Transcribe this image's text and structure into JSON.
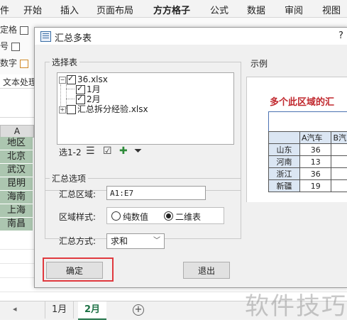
{
  "ribbon": {
    "tabs": [
      "件",
      "开始",
      "插入",
      "页面布局",
      "方方格子",
      "公式",
      "数据",
      "审阅",
      "视图"
    ],
    "active_tab": "方方格子",
    "left_items": [
      "定格",
      "号",
      "数字"
    ],
    "text_processing": "文本处理"
  },
  "sheet": {
    "column_header": "A",
    "cells": [
      "地区",
      "北京",
      "武汉",
      "昆明",
      "海南",
      "上海",
      "南昌"
    ]
  },
  "sheet_tabs": [
    "1月",
    "2月"
  ],
  "active_sheet": "2月",
  "dialog": {
    "title": "汇总多表",
    "help": "?",
    "select_table_label": "选择表",
    "tree": {
      "workbook1": "36.xlsx",
      "child1": "1月",
      "child2": "2月",
      "workbook2": "汇总拆分经验.xlsx"
    },
    "toolbar_label": "选1-2",
    "options_label": "汇总选项",
    "range_label": "汇总区域:",
    "range_value": "A1:E7",
    "style_label": "区域样式:",
    "style_option1": "纯数值",
    "style_option2": "二维表",
    "method_label": "汇总方式:",
    "method_value": "求和",
    "ok": "确定",
    "exit": "退出",
    "example_label": "示例",
    "example": {
      "title": "多个此区域的汇",
      "header": [
        "",
        "A汽车",
        "B汽"
      ],
      "rows": [
        [
          "山东",
          "36",
          ""
        ],
        [
          "河南",
          "13",
          ""
        ],
        [
          "浙江",
          "36",
          ""
        ],
        [
          "新疆",
          "19",
          ""
        ]
      ]
    }
  },
  "watermark": "软件技巧"
}
